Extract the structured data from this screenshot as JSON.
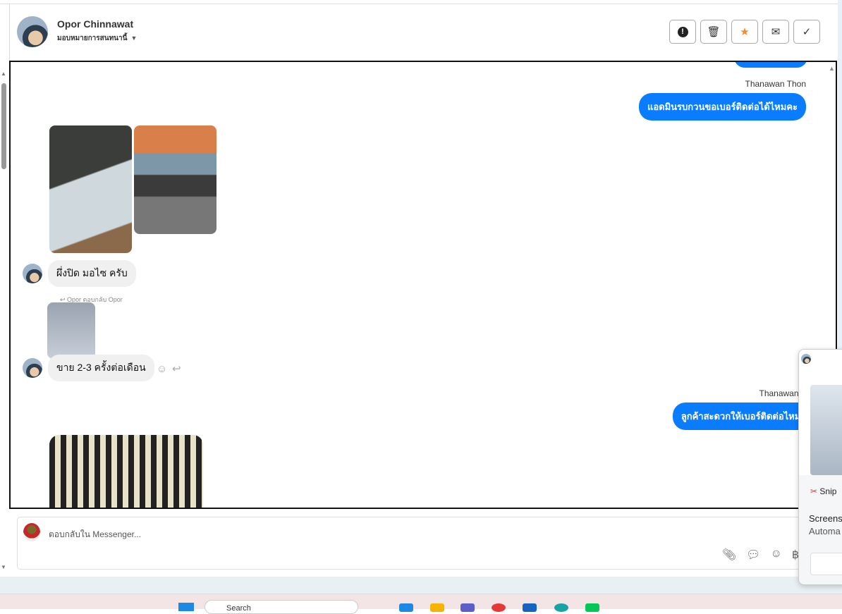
{
  "header": {
    "contact_name": "Opor Chinnawat",
    "assign_label": "มอบหมายการสนทนานี้",
    "actions": [
      {
        "name": "spam",
        "icon": "exclamation-circle-icon"
      },
      {
        "name": "delete",
        "icon": "trash-icon"
      },
      {
        "name": "star",
        "icon": "star-icon",
        "color": "#f5892b"
      },
      {
        "name": "mark-unread",
        "icon": "envelope-icon"
      },
      {
        "name": "done",
        "icon": "check-icon"
      }
    ]
  },
  "messages": {
    "out1_sender": "Thanawan Thon",
    "out1_text": "แอดมินรบกวนขอเบอร์ติดต่อได้ไหมคะ",
    "in1_text": "ผึ่งปิด มอไซ ครับ",
    "reply_label": "Opor ตอบกลับ Opor",
    "in2_text": "ขาย 2-3 ครั้งต่อเดือน",
    "out2_sender": "Thanawan Thon",
    "out2_text": "ลูกค้าสะดวกให้เบอร์ติดต่อไหมคะ"
  },
  "composer": {
    "placeholder": "ตอบกลับใน Messenger...",
    "currency_symbol": "฿"
  },
  "notification": {
    "app": "Snip",
    "title": "Screens",
    "subtitle": "Automa"
  },
  "taskbar": {
    "search_text": "Search"
  },
  "colors": {
    "accent": "#0a7cff"
  }
}
